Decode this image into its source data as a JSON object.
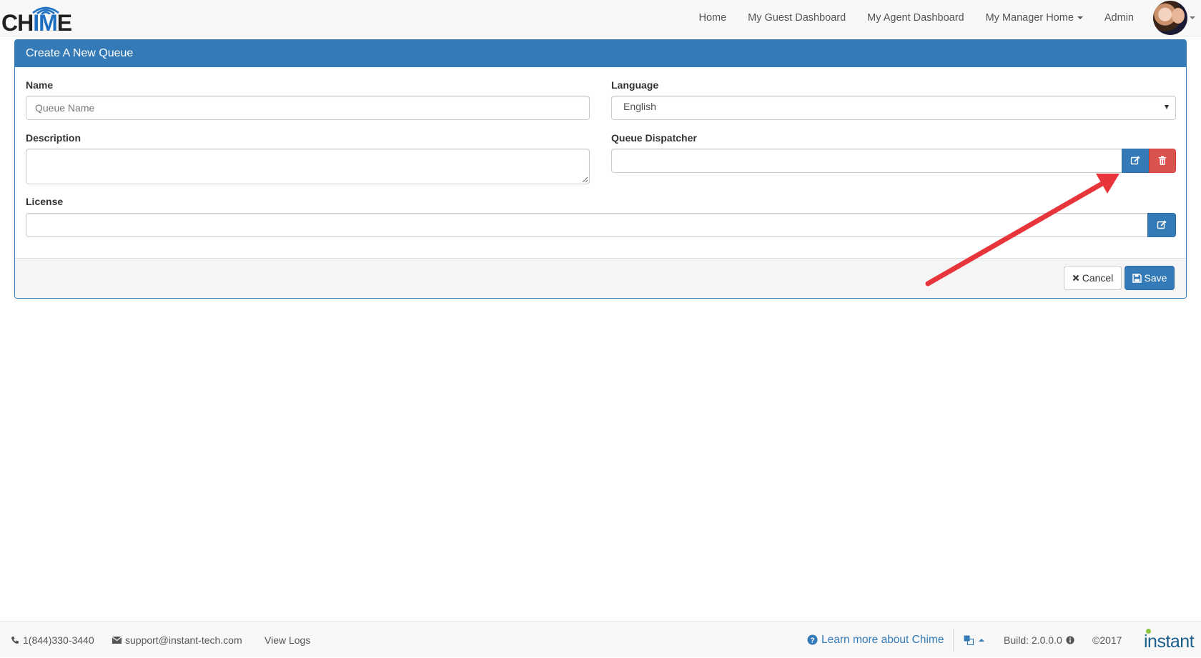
{
  "brand": {
    "logo_part1": "CH",
    "logo_part2": "IM",
    "logo_part3": "E",
    "blue": "#1d6fc1"
  },
  "nav": {
    "items": [
      {
        "label": "Home"
      },
      {
        "label": "My Guest Dashboard"
      },
      {
        "label": "My Agent Dashboard"
      },
      {
        "label": "My Manager Home",
        "dropdown": true
      },
      {
        "label": "Admin"
      }
    ],
    "avatar_icon": "user-avatar"
  },
  "panel": {
    "title": "Create A New Queue",
    "accent": "#337ab7",
    "fields": {
      "name": {
        "label": "Name",
        "placeholder": "Queue Name",
        "value": ""
      },
      "language": {
        "label": "Language",
        "value": "English"
      },
      "description": {
        "label": "Description",
        "value": ""
      },
      "dispatcher": {
        "label": "Queue Dispatcher",
        "value": "",
        "edit_icon": "edit-icon",
        "delete_icon": "trash-icon"
      },
      "license": {
        "label": "License",
        "value": "",
        "edit_icon": "edit-icon"
      }
    },
    "actions": {
      "cancel_label": "Cancel",
      "save_label": "Save",
      "cancel_icon": "close-icon",
      "save_icon": "floppy-disk-icon"
    },
    "danger_color": "#d9534f"
  },
  "annotation": {
    "type": "arrow",
    "color": "#e8353b"
  },
  "footer": {
    "phone": "1(844)330-3440",
    "email": "support@instant-tech.com",
    "view_logs": "View Logs",
    "learn_more": "Learn more about Chime",
    "build": "Build: 2.0.0.0",
    "copyright": "©2017",
    "company_logo": "instant"
  }
}
